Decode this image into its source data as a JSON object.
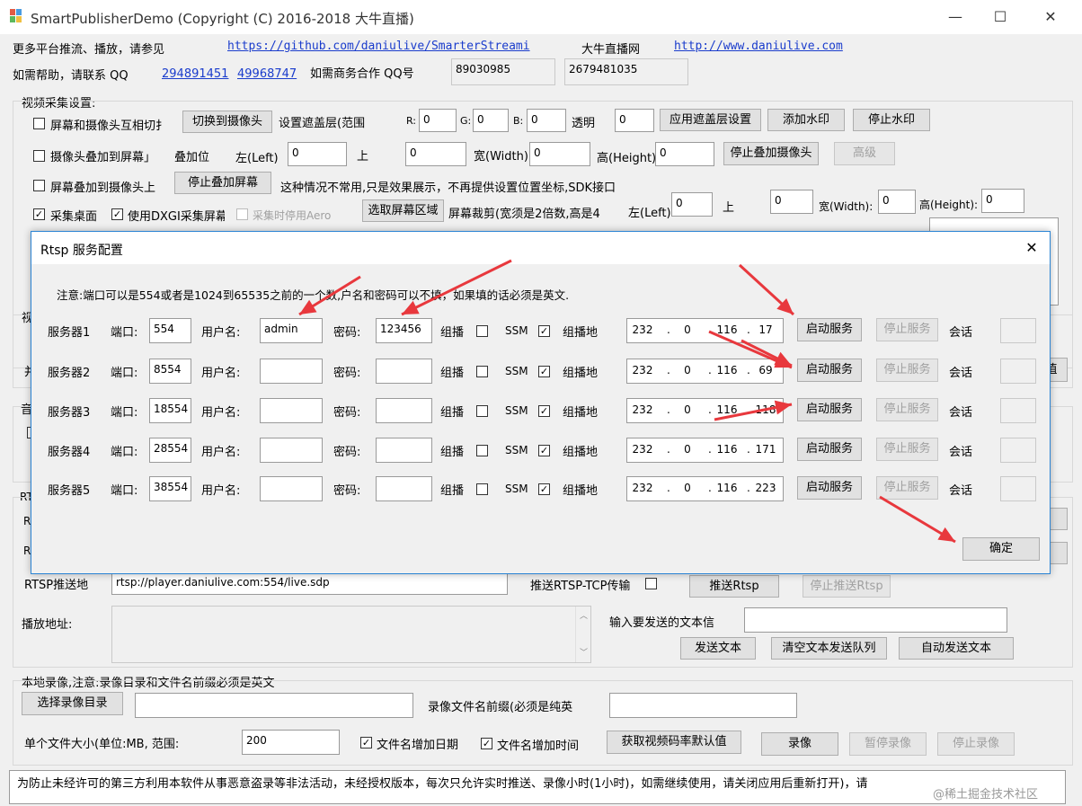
{
  "window": {
    "title": "SmartPublisherDemo  (Copyright (C) 2016-2018 大牛直播)",
    "minimize": "—",
    "maximize": "☐",
    "close": "✕"
  },
  "info": {
    "more_platforms": "更多平台推流、播放，请参见",
    "github_url": "https://github.com/daniulive/SmarterStreami",
    "brand_site_label": "大牛直播网",
    "site_url": "http://www.daniulive.com",
    "help_label": "如需帮助，请联系 QQ",
    "qq1": "294891451",
    "qq2": "49968747",
    "business_label": "如需商务合作 QQ号",
    "biz_qq1": "89030985",
    "biz_qq2": "2679481035"
  },
  "capture": {
    "group_label": "视频采集设置:",
    "row1": {
      "checkbox_label": "屏幕和摄像头互相切扌",
      "switch_btn": "切换到摄像头",
      "mask_label": "设置遮盖层(范围",
      "r_label": "R:",
      "r_value": "0",
      "g_label": "G:",
      "g_value": "0",
      "b_label": "B:",
      "b_value": "0",
      "alpha_label": "透明",
      "alpha_value": "0",
      "apply_mask_btn": "应用遮盖层设置",
      "add_watermark_btn": "添加水印",
      "stop_watermark_btn": "停止水印"
    },
    "row2": {
      "checkbox_label": "摄像头叠加到屏幕」",
      "overlay_pos_label": "叠加位",
      "left_label": "左(Left)",
      "left_value": "0",
      "top_label": "上",
      "top_value": "0",
      "width_label": "宽(Width)",
      "width_value": "0",
      "height_label": "高(Height)",
      "height_value": "0",
      "stop_overlay_camera_btn": "停止叠加摄像头",
      "advanced_btn": "高级"
    },
    "row3": {
      "checkbox_label": "屏幕叠加到摄像头上",
      "stop_overlay_screen_btn": "停止叠加屏幕",
      "note": "这种情况不常用,只是效果展示，不再提供设置位置坐标,SDK接口"
    },
    "row4": {
      "desktop_label": "采集桌面",
      "desktop_checked": "✓",
      "dxgi_label": "使用DXGI采集屏幕",
      "dxgi_checked": "✓",
      "aero_label": "采集时停用Aero",
      "select_region_btn": "选取屏幕区域",
      "crop_label": "屏幕裁剪(宽须是2倍数,高是4",
      "left_label": "左(Left):",
      "left_value": "0",
      "top_label": "上",
      "top_value": "0",
      "width_label": "宽(Width):",
      "width_value": "0",
      "height_label": "高(Height):",
      "height_value": "0"
    },
    "hidden_left_labels": [
      "视",
      "并",
      "音",
      "RTS",
      "R",
      "R"
    ],
    "hidden_right_btn_label": "值"
  },
  "rtsp_dialog": {
    "title": "Rtsp 服务配置",
    "close": "✕",
    "note": "注意:端口可以是554或者是1024到65535之前的一个数,户名和密码可以不填，如果填的话必须是英文.",
    "port_label": "端口:",
    "user_label": "用户名:",
    "pass_label": "密码:",
    "multicast_label": "组播",
    "ssm_label": "SSM",
    "multicast_addr_label": "组播地",
    "start_btn": "启动服务",
    "stop_btn": "停止服务",
    "session_label": "会话",
    "ok_btn": "确定",
    "servers": [
      {
        "name": "服务器1",
        "port": "554",
        "user": "admin",
        "password": "123456",
        "multicast": "",
        "ssm": "✓",
        "ip": [
          "232",
          "0",
          "116",
          "17"
        ]
      },
      {
        "name": "服务器2",
        "port": "8554",
        "user": "",
        "password": "",
        "multicast": "",
        "ssm": "✓",
        "ip": [
          "232",
          "0",
          "116",
          "69"
        ]
      },
      {
        "name": "服务器3",
        "port": "18554",
        "user": "",
        "password": "",
        "multicast": "",
        "ssm": "✓",
        "ip": [
          "232",
          "0",
          "116",
          "118"
        ]
      },
      {
        "name": "服务器4",
        "port": "28554",
        "user": "",
        "password": "",
        "multicast": "",
        "ssm": "✓",
        "ip": [
          "232",
          "0",
          "116",
          "171"
        ]
      },
      {
        "name": "服务器5",
        "port": "38554",
        "user": "",
        "password": "",
        "multicast": "",
        "ssm": "✓",
        "ip": [
          "232",
          "0",
          "116",
          "223"
        ]
      }
    ],
    "annotation_color": "#e8383d"
  },
  "push": {
    "rtsp_push_label": "RTSP推送地",
    "rtsp_url": "rtsp://player.daniulive.com:554/live.sdp",
    "tcp_label": "推送RTSP-TCP传输",
    "push_btn": "推送Rtsp",
    "stop_push_btn": "停止推送Rtsp",
    "play_addr_label": "播放地址:",
    "text_input_label": "输入要发送的文本信",
    "send_text_btn": "发送文本",
    "clear_queue_btn": "清空文本发送队列",
    "auto_send_btn": "自动发送文本"
  },
  "record": {
    "group_label": "本地录像,注意:录像目录和文件名前缀必须是英文",
    "select_dir_btn": "选择录像目录",
    "prefix_label": "录像文件名前缀(必须是纯英",
    "size_label": "单个文件大小(单位:MB, 范围:",
    "size_value": "200",
    "add_date_label": "文件名增加日期",
    "add_time_label": "文件名增加时间",
    "get_bitrate_btn": "获取视频码率默认值",
    "record_btn": "录像",
    "pause_btn": "暂停录像",
    "stop_btn": "停止录像"
  },
  "status": {
    "text": "为防止未经许可的第三方利用本软件从事恶意盗录等非法活动，未经授权版本，每次只允许实时推送、录像小时(1小时)，如需继续使用，请关闭应用后重新打开)，请",
    "watermark": "@稀土掘金技术社区"
  },
  "colors": {
    "accent": "#2b84d4",
    "link": "#1a3ccc",
    "arrow": "#e8383d"
  }
}
